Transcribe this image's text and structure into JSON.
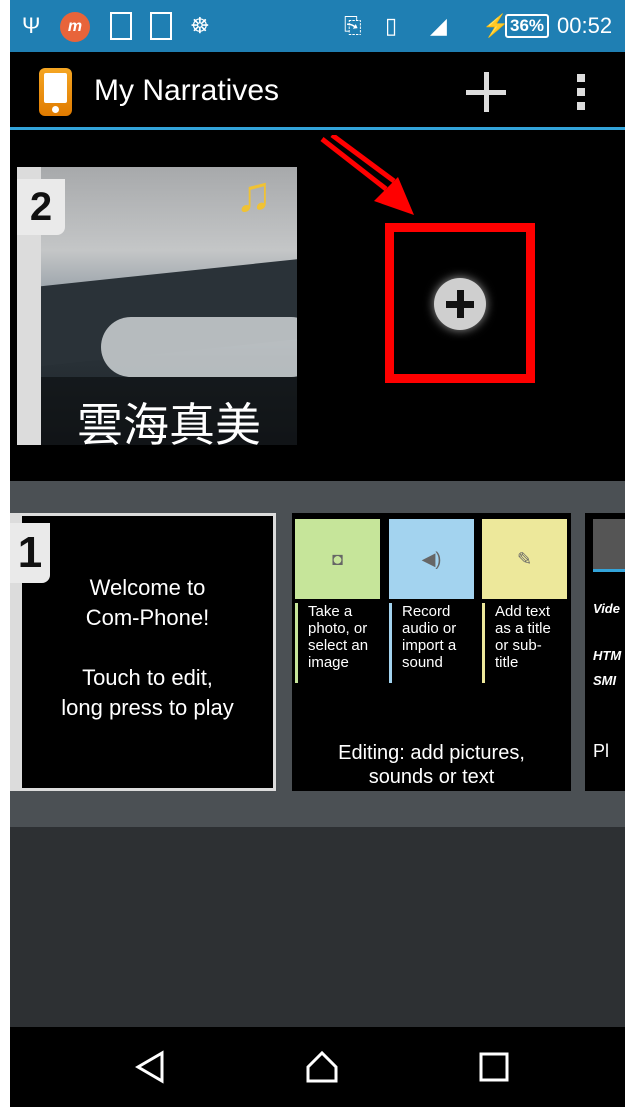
{
  "status_bar": {
    "icons": [
      "usb-icon",
      "m-app-icon",
      "sim-icon",
      "notes-icon",
      "android-icon",
      "cast-icon",
      "vibrate-icon",
      "signal-icon",
      "charging-icon"
    ],
    "battery": "36%",
    "time": "00:52",
    "background_color": "#1f7fb3"
  },
  "action_bar": {
    "title": "My Narratives",
    "accent_color": "#33a4da"
  },
  "narratives": [
    {
      "number": "2",
      "caption": "雲海真美",
      "has_audio": true
    },
    {
      "number": "1",
      "lines": "Welcome to\nCom-Phone!\n\nTouch to edit,\nlong press to play"
    }
  ],
  "tutorial": {
    "columns": [
      {
        "color": "#c6e59a",
        "lines": [
          "Take a",
          "photo, or",
          "select an",
          "image"
        ]
      },
      {
        "color": "#a3d3ef",
        "lines": [
          "Record",
          "audio or",
          "import a",
          "sound"
        ]
      },
      {
        "color": "#ede89b",
        "lines": [
          "Add text",
          "as a title",
          "or sub-",
          "title"
        ]
      }
    ],
    "caption_line1": "Editing: add pictures,",
    "caption_line2": "sounds or text"
  },
  "partial_card": {
    "lines": [
      "Vide",
      "HTM",
      "SMI",
      "Pl"
    ]
  },
  "highlight_color": "#ff0000"
}
